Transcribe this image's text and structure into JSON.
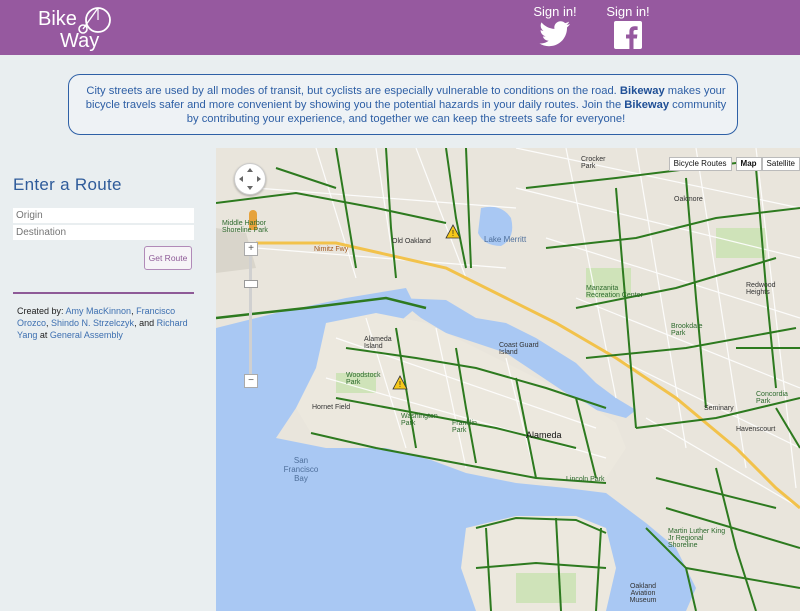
{
  "header": {
    "logo_word1": "Bike",
    "logo_word2": "Way",
    "twitter_label": "Sign in!",
    "facebook_label": "Sign in!"
  },
  "intro": {
    "text_part1": "City streets are used by all modes of transit, but cyclists are especially vulnerable to conditions on the road. ",
    "brand1": "Bikeway",
    "text_part2": " makes your bicycle travels safer and more convenient by showing you the potential hazards in your daily routes. Join the ",
    "brand2": "Bikeway",
    "text_part3": " community by contributing your experience, and together we can keep the streets safe for everyone!"
  },
  "route": {
    "title": "Enter a Route",
    "origin_placeholder": "Origin",
    "destination_placeholder": "Destination",
    "submit_label": "Get Route"
  },
  "credits": {
    "prefix": "Created by: ",
    "author1": "Amy MacKinnon",
    "sep1": ", ",
    "author2": "Francisco Orozco",
    "sep2": ", ",
    "author3": "Shindo N. Strzelczyk",
    "sep3": ", and ",
    "author4": "Richard Yang",
    "at": " at ",
    "org": "General Assembly"
  },
  "map": {
    "bicycle_routes_label": "Bicycle Routes",
    "map_label": "Map",
    "satellite_label": "Satellite",
    "zoom_in": "+",
    "zoom_out": "−",
    "labels": {
      "alameda": "Alameda",
      "alameda_island": "Alameda Island",
      "sf_bay": "San Francisco Bay",
      "coast_guard": "Coast Guard Island",
      "oakland": "Old Oakland",
      "lake_merritt": "Lake Merritt",
      "woodstock": "Woodstock Park",
      "washington": "Washington Park",
      "franklin": "Franklin Park",
      "lincoln": "Lincoln Park",
      "manzanita": "Manzanita Recreation Center",
      "brookdale": "Brookdale Park",
      "concordia": "Concordia Park",
      "redwood": "Redwood Heights",
      "crocker": "Crocker Park",
      "oakmore": "Oakmore",
      "seminary": "Seminary",
      "havenscourt": "Havenscourt",
      "airport": "Oakland Aviation Museum",
      "hornet": "Hornet Field",
      "middle_harbor": "Middle Harbor Shoreline Park",
      "nimitz": "Nimitz Fwy",
      "mlk": "Martin Luther King Jr Regional Shoreline"
    }
  },
  "colors": {
    "header": "#96599f",
    "accent": "#2e5fa5",
    "bike_route": "#2d7a1f",
    "water": "#a9c8f3"
  }
}
